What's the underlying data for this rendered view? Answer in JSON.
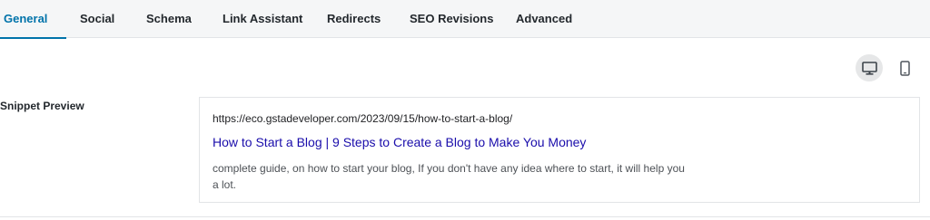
{
  "tabs": [
    {
      "label": "General",
      "active": true
    },
    {
      "label": "Social",
      "active": false
    },
    {
      "label": "Schema",
      "active": false
    },
    {
      "label": "Link Assistant",
      "active": false
    },
    {
      "label": "Redirects",
      "active": false
    },
    {
      "label": "SEO Revisions",
      "active": false
    },
    {
      "label": "Advanced",
      "active": false
    }
  ],
  "device_toggle": {
    "desktop_icon": "desktop-icon",
    "mobile_icon": "mobile-icon",
    "selected": "desktop"
  },
  "snippet": {
    "section_label": "Snippet Preview",
    "url": "https://eco.gstadeveloper.com/2023/09/15/how-to-start-a-blog/",
    "title": "How to Start a Blog | 9 Steps to Create a Blog to Make You Money",
    "description": "complete guide, on how to start your blog, If you don't have any idea where to start, it will help you a lot."
  },
  "colors": {
    "accent": "#0073aa",
    "link_title": "#1a0dab",
    "tab_bar_bg": "#f5f6f7"
  }
}
